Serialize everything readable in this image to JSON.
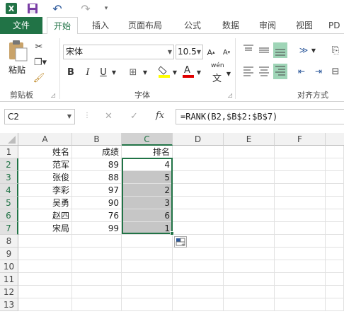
{
  "quick_access": {
    "logo_letter": "X",
    "undo_glyph": "↶",
    "redo_glyph": "↷",
    "more_glyph": "▾"
  },
  "tabs": [
    {
      "label": "文件"
    },
    {
      "label": "开始"
    },
    {
      "label": "插入"
    },
    {
      "label": "页面布局"
    },
    {
      "label": "公式"
    },
    {
      "label": "数据"
    },
    {
      "label": "审阅"
    },
    {
      "label": "视图"
    },
    {
      "label": "PD"
    }
  ],
  "ribbon": {
    "clipboard": {
      "paste_label": "粘贴",
      "group_label": "剪贴板"
    },
    "font": {
      "name": "宋体",
      "size": "10.5",
      "group_label": "字体",
      "bold": "B",
      "italic": "I",
      "underline": "U",
      "phonetic": "wén"
    },
    "alignment": {
      "group_label": "对齐方式"
    }
  },
  "formula_bar": {
    "name_box": "C2",
    "formula": "=RANK(B2,$B$2:$B$7)",
    "fx_label": "fx",
    "cancel_glyph": "✕",
    "enter_glyph": "✓"
  },
  "sheet": {
    "columns": [
      "A",
      "B",
      "C",
      "D",
      "E",
      "F"
    ],
    "rows": [
      "1",
      "2",
      "3",
      "4",
      "5",
      "6",
      "7",
      "8",
      "9",
      "10",
      "11",
      "12",
      "13"
    ],
    "header_row": {
      "name": "姓名",
      "score": "成绩",
      "rank": "排名"
    },
    "data": [
      {
        "name": "范军",
        "score": "89",
        "rank": "4"
      },
      {
        "name": "张俊",
        "score": "88",
        "rank": "5"
      },
      {
        "name": "李彩",
        "score": "97",
        "rank": "2"
      },
      {
        "name": "吴勇",
        "score": "90",
        "rank": "3"
      },
      {
        "name": "赵四",
        "score": "76",
        "rank": "6"
      },
      {
        "name": "宋局",
        "score": "99",
        "rank": "1"
      }
    ]
  },
  "colors": {
    "accent": "#217346",
    "selection_fill": "#c6c6c6",
    "paste_highlight": "#9fd5b7"
  }
}
